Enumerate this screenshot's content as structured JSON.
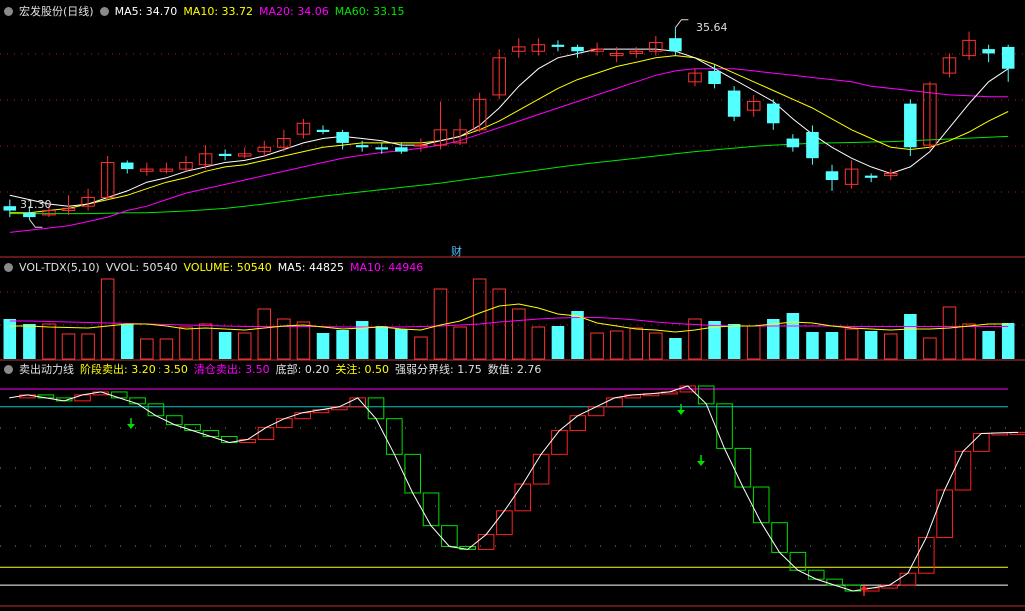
{
  "price_panel": {
    "title": "宏发股份(日线)",
    "ma5_label": "MA5: 34.70",
    "ma10_label": "MA10: 33.72",
    "ma20_label": "MA20: 34.06",
    "ma60_label": "MA60: 33.15",
    "high_marker": "35.64",
    "low_marker": "31.30",
    "finance_marker": "财"
  },
  "volume_panel": {
    "title": "VOL-TDX(5,10)",
    "vvol_label": "VVOL: 50540",
    "volume_label": "VOLUME: 50540",
    "ma5_label": "MA5: 44825",
    "ma10_label": "MA10: 44946"
  },
  "indicator_panel": {
    "title": "卖出动力线",
    "stage_sell_label": "阶段卖出: 3.20",
    "stage_sell_value2": "3.50",
    "clear_sell_label": "清仓卖出: 3.50",
    "bottom_label": "底部: 0.20",
    "focus_label": "关注: 0.50",
    "divider_label": "强弱分界线: 1.75",
    "value_label": "数值: 2.76"
  },
  "colors": {
    "up": "#ff3232",
    "down": "#54ffff",
    "ma5": "#ffffff",
    "ma10": "#ffff00",
    "ma20": "#ff00ff",
    "ma60": "#00e600",
    "grid": "#b0202a"
  },
  "chart_data": [
    {
      "type": "candlestick",
      "name": "price",
      "candles": [
        [
          31.55,
          31.45,
          31.7,
          31.3
        ],
        [
          31.4,
          31.3,
          31.55,
          31.25
        ],
        [
          31.35,
          31.45,
          31.6,
          31.3
        ],
        [
          31.45,
          31.5,
          31.8,
          31.35
        ],
        [
          31.55,
          31.75,
          31.95,
          31.45
        ],
        [
          31.75,
          32.55,
          32.7,
          31.7
        ],
        [
          32.55,
          32.4,
          32.6,
          32.3
        ],
        [
          32.35,
          32.4,
          32.55,
          32.25
        ],
        [
          32.35,
          32.4,
          32.55,
          32.3
        ],
        [
          32.4,
          32.55,
          32.7,
          32.35
        ],
        [
          32.5,
          32.75,
          32.95,
          32.4
        ],
        [
          32.75,
          32.7,
          32.85,
          32.6
        ],
        [
          32.7,
          32.75,
          32.9,
          32.65
        ],
        [
          32.8,
          32.9,
          33.05,
          32.7
        ],
        [
          32.9,
          33.1,
          33.3,
          32.8
        ],
        [
          33.2,
          33.45,
          33.55,
          33.1
        ],
        [
          33.3,
          33.25,
          33.4,
          33.2
        ],
        [
          33.25,
          33.0,
          33.3,
          32.85
        ],
        [
          32.95,
          32.9,
          33.05,
          32.8
        ],
        [
          32.9,
          32.85,
          33.0,
          32.75
        ],
        [
          32.9,
          32.8,
          33.0,
          32.75
        ],
        [
          32.95,
          32.95,
          33.1,
          32.8
        ],
        [
          32.95,
          33.3,
          33.95,
          32.85
        ],
        [
          33.0,
          33.3,
          33.55,
          32.95
        ],
        [
          33.3,
          34.0,
          34.15,
          33.25
        ],
        [
          34.1,
          34.95,
          35.15,
          34.0
        ],
        [
          35.1,
          35.2,
          35.4,
          34.95
        ],
        [
          35.1,
          35.25,
          35.4,
          35.0
        ],
        [
          35.25,
          35.2,
          35.35,
          35.1
        ],
        [
          35.2,
          35.1,
          35.25,
          34.95
        ],
        [
          35.1,
          35.15,
          35.3,
          35.0
        ],
        [
          35.0,
          35.05,
          35.2,
          34.85
        ],
        [
          35.05,
          35.1,
          35.2,
          34.95
        ],
        [
          35.1,
          35.3,
          35.45,
          35.0
        ],
        [
          35.4,
          35.1,
          35.64,
          35.0
        ],
        [
          34.4,
          34.6,
          34.7,
          34.3
        ],
        [
          34.65,
          34.35,
          34.8,
          34.25
        ],
        [
          34.2,
          33.6,
          34.3,
          33.5
        ],
        [
          33.75,
          33.95,
          34.1,
          33.6
        ],
        [
          33.9,
          33.45,
          34.0,
          33.3
        ],
        [
          33.1,
          32.9,
          33.2,
          32.8
        ],
        [
          33.25,
          32.65,
          33.4,
          32.5
        ],
        [
          32.35,
          32.15,
          32.5,
          31.9
        ],
        [
          32.05,
          32.4,
          32.6,
          31.95
        ],
        [
          32.25,
          32.2,
          32.3,
          32.1
        ],
        [
          32.25,
          32.3,
          32.4,
          32.15
        ],
        [
          33.9,
          32.9,
          34.0,
          32.7
        ],
        [
          32.95,
          34.35,
          34.4,
          32.85
        ],
        [
          34.6,
          34.95,
          35.05,
          34.5
        ],
        [
          35.0,
          35.35,
          35.55,
          34.9
        ],
        [
          35.15,
          35.05,
          35.25,
          34.85
        ],
        [
          35.2,
          34.7,
          35.25,
          34.4
        ]
      ],
      "ma5": [
        31.8,
        31.7,
        31.6,
        31.55,
        31.6,
        31.75,
        31.9,
        32.1,
        32.2,
        32.35,
        32.45,
        32.55,
        32.6,
        32.7,
        32.85,
        33.0,
        33.1,
        33.15,
        33.1,
        33.05,
        32.95,
        32.95,
        33.05,
        33.15,
        33.4,
        33.8,
        34.3,
        34.7,
        34.95,
        35.05,
        35.15,
        35.15,
        35.15,
        35.15,
        35.1,
        34.95,
        34.7,
        34.45,
        34.2,
        33.95,
        33.55,
        33.2,
        32.9,
        32.65,
        32.45,
        32.3,
        32.45,
        32.8,
        33.35,
        33.9,
        34.4,
        34.7
      ],
      "ma10": [
        31.4,
        31.4,
        31.45,
        31.5,
        31.6,
        31.7,
        31.8,
        31.95,
        32.1,
        32.2,
        32.35,
        32.45,
        32.5,
        32.6,
        32.7,
        32.8,
        32.9,
        32.95,
        33.0,
        33.0,
        33.0,
        33.0,
        33.05,
        33.15,
        33.3,
        33.5,
        33.75,
        34.0,
        34.25,
        34.45,
        34.6,
        34.75,
        34.85,
        34.95,
        35.0,
        34.95,
        34.8,
        34.6,
        34.4,
        34.2,
        34.0,
        33.8,
        33.55,
        33.3,
        33.1,
        32.9,
        32.85,
        32.9,
        33.05,
        33.25,
        33.5,
        33.72
      ],
      "ma20": [
        30.95,
        31.0,
        31.05,
        31.1,
        31.2,
        31.3,
        31.45,
        31.55,
        31.7,
        31.85,
        31.95,
        32.05,
        32.15,
        32.25,
        32.35,
        32.45,
        32.55,
        32.65,
        32.72,
        32.78,
        32.82,
        32.88,
        32.95,
        33.05,
        33.2,
        33.35,
        33.5,
        33.65,
        33.8,
        33.95,
        34.1,
        34.25,
        34.4,
        34.55,
        34.65,
        34.7,
        34.7,
        34.7,
        34.65,
        34.6,
        34.55,
        34.5,
        34.45,
        34.4,
        34.3,
        34.25,
        34.2,
        34.15,
        34.1,
        34.08,
        34.06,
        34.06
      ],
      "ma60": [
        31.38,
        31.38,
        31.38,
        31.38,
        31.38,
        31.39,
        31.4,
        31.4,
        31.42,
        31.44,
        31.47,
        31.5,
        31.55,
        31.6,
        31.66,
        31.72,
        31.78,
        31.83,
        31.88,
        31.93,
        31.98,
        32.03,
        32.08,
        32.14,
        32.2,
        32.26,
        32.32,
        32.38,
        32.44,
        32.5,
        32.55,
        32.6,
        32.65,
        32.7,
        32.75,
        32.8,
        32.84,
        32.88,
        32.92,
        32.95,
        32.97,
        32.99,
        33.0,
        33.01,
        33.02,
        33.03,
        33.05,
        33.07,
        33.09,
        33.11,
        33.13,
        33.15
      ]
    },
    {
      "type": "bar",
      "name": "volume",
      "values": [
        40000,
        35000,
        35000,
        25000,
        25000,
        80000,
        35000,
        20000,
        20000,
        32000,
        35000,
        27000,
        26000,
        50000,
        40000,
        37000,
        26000,
        29000,
        38000,
        33000,
        30000,
        22000,
        70000,
        32000,
        80000,
        70000,
        50000,
        32000,
        33000,
        48000,
        26000,
        28000,
        31000,
        26000,
        21000,
        40000,
        38000,
        35000,
        33000,
        40000,
        46000,
        27000,
        27000,
        30000,
        28000,
        25000,
        45000,
        21000,
        52000,
        35000,
        28000,
        36000
      ],
      "ma5": [
        33000,
        33000,
        32000,
        31500,
        31000,
        33000,
        35000,
        35000,
        33000,
        30000,
        31000,
        30000,
        29000,
        31000,
        33000,
        34000,
        32000,
        30000,
        31000,
        32000,
        30000,
        29000,
        34000,
        38000,
        46000,
        53000,
        55000,
        51000,
        45000,
        43000,
        36000,
        33000,
        30000,
        29000,
        27000,
        29000,
        32000,
        33000,
        33000,
        35000,
        37000,
        36000,
        33000,
        31000,
        30000,
        29000,
        30000,
        30000,
        31000,
        33000,
        35000,
        35000
      ],
      "ma10": [
        38000,
        38000,
        37500,
        37000,
        36500,
        36000,
        35500,
        35000,
        34500,
        34000,
        33500,
        33000,
        32500,
        32500,
        32500,
        32500,
        32500,
        32000,
        32000,
        32000,
        32000,
        32500,
        33000,
        34000,
        35000,
        37000,
        38500,
        40000,
        41000,
        41500,
        41500,
        40500,
        39000,
        37000,
        35500,
        34500,
        33500,
        33000,
        33000,
        33000,
        33000,
        33000,
        33000,
        32500,
        32500,
        32500,
        32500,
        32500,
        32500,
        32500,
        32500,
        32500
      ]
    },
    {
      "type": "line",
      "name": "sell_power",
      "values": [
        3.35,
        3.4,
        3.35,
        3.3,
        3.4,
        3.45,
        3.35,
        3.25,
        3.05,
        2.9,
        2.8,
        2.7,
        2.6,
        2.65,
        2.85,
        3.0,
        3.1,
        3.15,
        3.2,
        3.35,
        3.0,
        2.4,
        1.75,
        1.2,
        0.85,
        0.8,
        1.05,
        1.45,
        1.9,
        2.4,
        2.8,
        3.05,
        3.2,
        3.35,
        3.4,
        3.42,
        3.45,
        3.55,
        3.25,
        2.5,
        1.85,
        1.25,
        0.75,
        0.45,
        0.3,
        0.2,
        0.1,
        0.15,
        0.2,
        0.4,
        1.0,
        1.8,
        2.45,
        2.75,
        2.76,
        2.77
      ],
      "bottom": 0.2,
      "focus": 0.5,
      "divider": 1.75,
      "stage_sell": 3.2,
      "clear_sell": 3.5
    }
  ]
}
